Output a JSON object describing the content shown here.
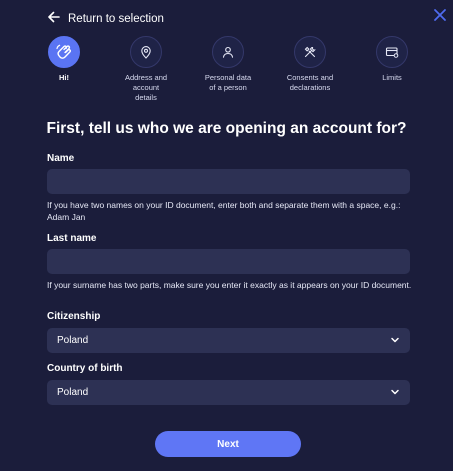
{
  "header": {
    "back_label": "Return to selection",
    "back_icon": "arrow-left-icon",
    "close_icon": "close-icon"
  },
  "steps": [
    {
      "label": "Hi!",
      "icon": "wave-hand-icon",
      "active": true
    },
    {
      "label": "Address and\naccount\ndetails",
      "icon": "location-pin-icon",
      "active": false
    },
    {
      "label": "Personal data\nof a person",
      "icon": "person-icon",
      "active": false
    },
    {
      "label": "Consents and\ndeclarations",
      "icon": "tools-icon",
      "active": false
    },
    {
      "label": "Limits",
      "icon": "card-settings-icon",
      "active": false
    }
  ],
  "heading": "First, tell us who we are opening an account for?",
  "form": {
    "name": {
      "label": "Name",
      "value": "",
      "hint": "If you have two names on your ID document, enter both and separate them with a space, e.g.: Adam Jan"
    },
    "last_name": {
      "label": "Last name",
      "value": "",
      "hint": "If your surname has two parts, make sure you enter it exactly as it appears on your ID document."
    },
    "citizenship": {
      "label": "Citizenship",
      "value": "Poland"
    },
    "country_of_birth": {
      "label": "Country of birth",
      "value": "Poland"
    }
  },
  "next_label": "Next",
  "colors": {
    "background": "#1b1d3b",
    "input_background": "#2d3154",
    "accent": "#5a74f3",
    "close": "#4f6bf0"
  }
}
